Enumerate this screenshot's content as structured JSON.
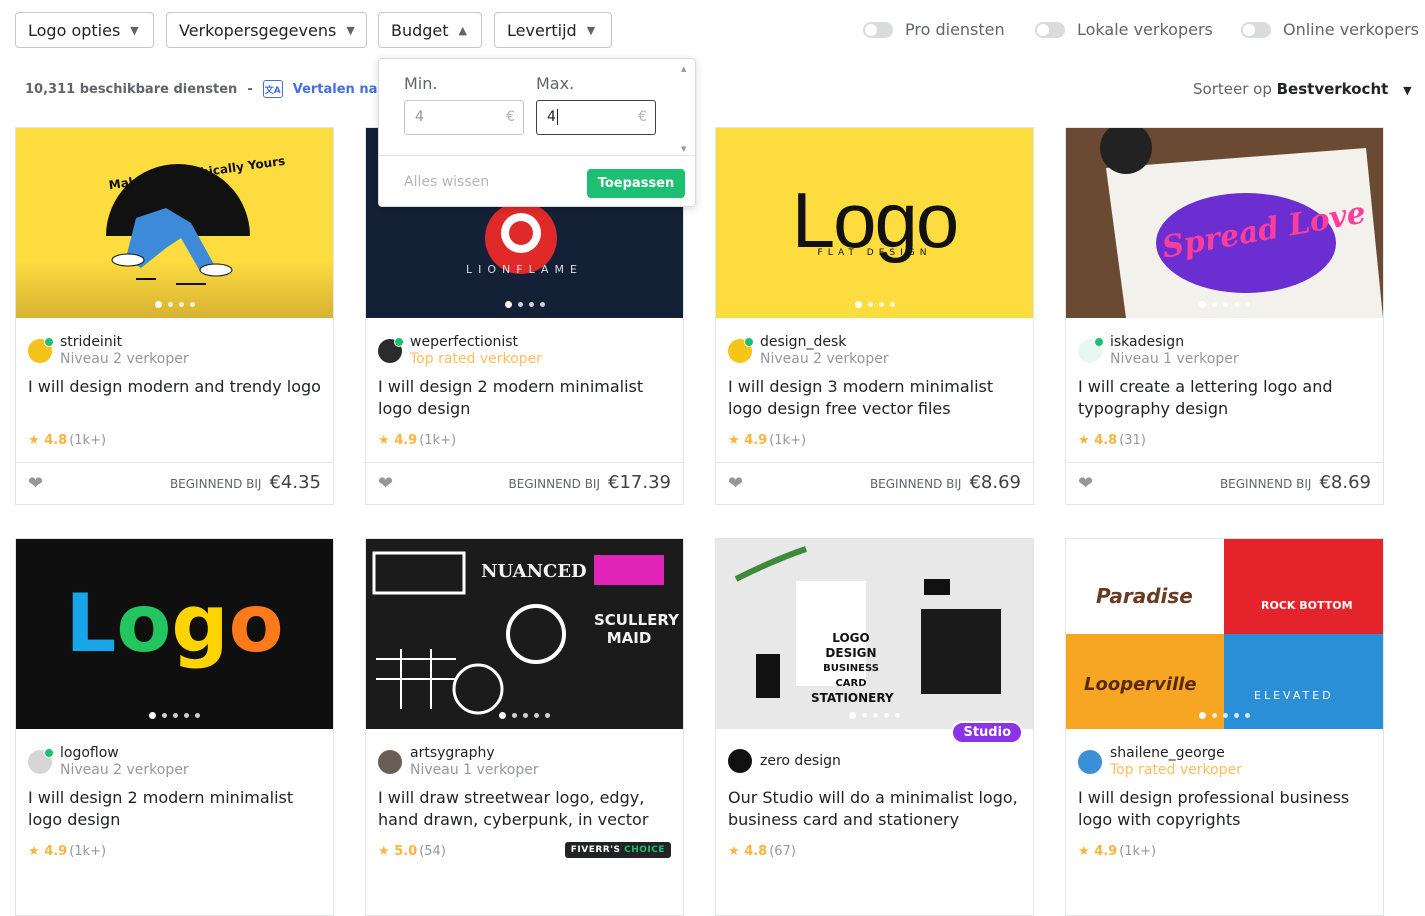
{
  "filters": {
    "logo": "Logo opties",
    "seller": "Verkopersgegevens",
    "budget": "Budget",
    "delivery": "Levertijd"
  },
  "toggles": {
    "pro": "Pro diensten",
    "local": "Lokale verkopers",
    "online": "Online verkopers"
  },
  "results": {
    "count": "10,311 beschikbare diensten",
    "dash": "-",
    "translate": "Vertalen naar he"
  },
  "sort": {
    "label": "Sorteer op",
    "value": "Bestverkocht"
  },
  "budget_popup": {
    "min_label": "Min.",
    "max_label": "Max.",
    "min_value": "4",
    "max_value": "4",
    "currency": "€",
    "clear": "Alles wissen",
    "apply": "Toepassen"
  },
  "price_label": "BEGINNEND BIJ",
  "gigs": [
    {
      "seller": "strideinit",
      "level": "Niveau 2 verkoper",
      "title": "I will design modern and trendy logo",
      "rating": "4.8",
      "count": "(1k+)",
      "price": "€4.35",
      "thumb_text": "Make us Graphically Yours"
    },
    {
      "seller": "weperfectionist",
      "level": "Top rated verkoper",
      "title": "I will design 2 modern minimalist logo design",
      "rating": "4.9",
      "count": "(1k+)",
      "price": "€17.39",
      "thumb_text": "LIONFLAME"
    },
    {
      "seller": "design_desk",
      "level": "Niveau 2 verkoper",
      "title": "I will design 3 modern minimalist logo design free vector files",
      "rating": "4.9",
      "count": "(1k+)",
      "price": "€8.69",
      "thumb_text": "Logo",
      "thumb_sub": "FLAT DESIGN"
    },
    {
      "seller": "iskadesign",
      "level": "Niveau 1 verkoper",
      "title": "I will create a lettering logo and typography design",
      "rating": "4.8",
      "count": "(31)",
      "price": "€8.69",
      "thumb_text": "Spread Love"
    },
    {
      "seller": "logoflow",
      "level": "Niveau 2 verkoper",
      "title": "I will design 2 modern minimalist logo design",
      "rating": "4.9",
      "count": "(1k+)",
      "thumb_text": "Logo"
    },
    {
      "seller": "artsygraphy",
      "level": "Niveau 1 verkoper",
      "title": "I will draw streetwear logo, edgy, hand drawn, cyberpunk, in vector",
      "rating": "5.0",
      "count": "(54)",
      "badge": "FIVERR'S",
      "badge2": "CHOICE",
      "thumb_text": "NUANCED",
      "thumb_sub": "SCULLERY MAID"
    },
    {
      "seller": "zero design",
      "level": "",
      "title": "Our Studio will do a minimalist logo, business card and stationery",
      "rating": "4.8",
      "count": "(67)",
      "studio": "Studio",
      "thumb_text": "LOGO DESIGN",
      "thumb_sub": "BUSINESS CARD",
      "thumb_sub2": "STATIONERY"
    },
    {
      "seller": "shailene_george",
      "level": "Top rated verkoper",
      "title": "I will design professional business logo with copyrights",
      "rating": "4.9",
      "count": "(1k+)",
      "thumb_text": "Paradise",
      "thumb_sub": "ROCK BOTTOM",
      "thumb_sub2": "Looperville",
      "thumb_sub3": "ELEVATED"
    }
  ]
}
